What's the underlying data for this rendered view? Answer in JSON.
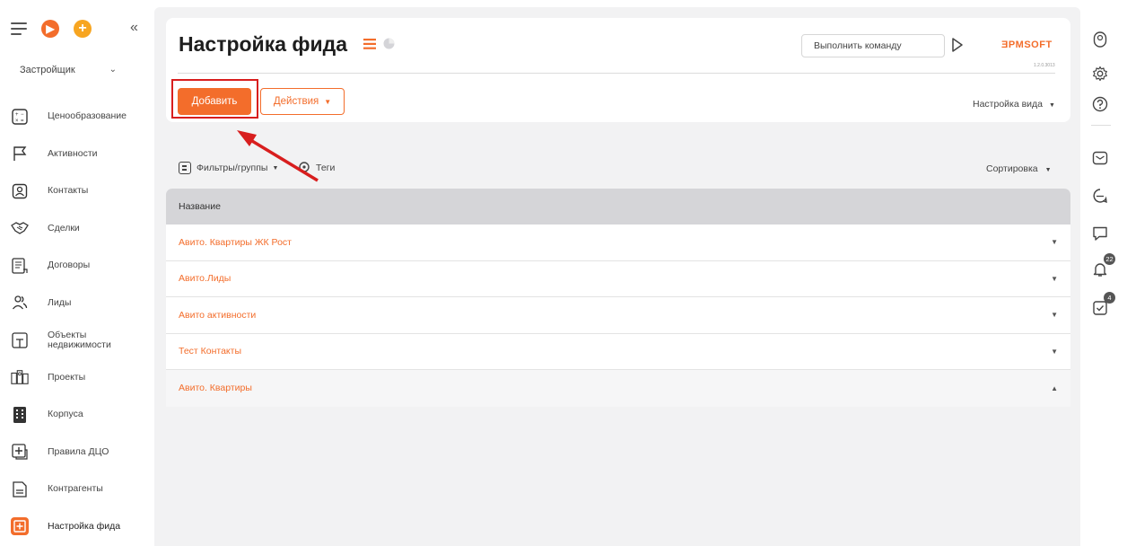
{
  "sidebar": {
    "role": "Застройщик",
    "items": [
      {
        "label": "Ценообразование",
        "icon": "pricing-icon"
      },
      {
        "label": "Активности",
        "icon": "flag-icon"
      },
      {
        "label": "Контакты",
        "icon": "contact-card-icon"
      },
      {
        "label": "Сделки",
        "icon": "handshake-icon"
      },
      {
        "label": "Договоры",
        "icon": "contract-icon"
      },
      {
        "label": "Лиды",
        "icon": "users-icon"
      },
      {
        "label": "Объекты недвижимости",
        "icon": "property-icon"
      },
      {
        "label": "Проекты",
        "icon": "projects-icon"
      },
      {
        "label": "Корпуса",
        "icon": "building-icon"
      },
      {
        "label": "Правила ДЦО",
        "icon": "rules-icon"
      },
      {
        "label": "Контрагенты",
        "icon": "document-icon"
      },
      {
        "label": "Настройка фида",
        "icon": "feed-settings-icon",
        "active": true
      }
    ]
  },
  "header": {
    "title": "Настройка фида",
    "command_placeholder": "Выполнить команду",
    "logo": "ƎPMSOFT",
    "version": "1.2.0.3013"
  },
  "toolbar": {
    "add_label": "Добавить",
    "actions_label": "Действия",
    "view_settings_label": "Настройка вида"
  },
  "filters": {
    "filters_label": "Фильтры/группы",
    "tags_label": "Теги",
    "sort_label": "Сортировка"
  },
  "table": {
    "column": "Название",
    "rows": [
      {
        "name": "Авито. Квартиры ЖК Рост",
        "expanded": false
      },
      {
        "name": "Авито.Лиды",
        "expanded": false
      },
      {
        "name": "Авито активности",
        "expanded": false
      },
      {
        "name": "Тест Контакты",
        "expanded": false
      },
      {
        "name": "Авито. Квартиры",
        "expanded": true
      }
    ]
  },
  "rail": {
    "notifications_count": "22",
    "tasks_count": "4"
  },
  "colors": {
    "accent": "#f36d2b",
    "highlight": "#d81e1e"
  }
}
